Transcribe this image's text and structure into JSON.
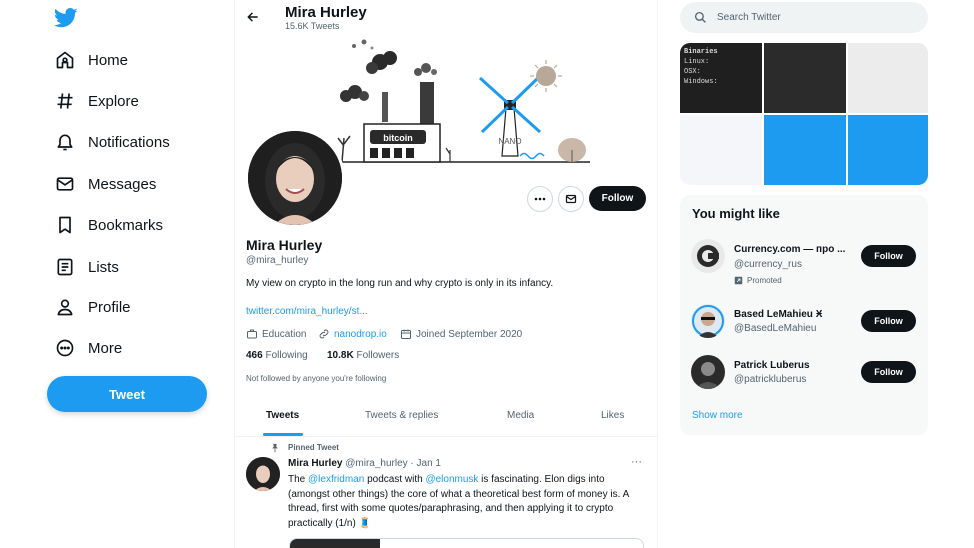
{
  "nav": {
    "items": [
      {
        "label": "Home",
        "icon": "home-icon"
      },
      {
        "label": "Explore",
        "icon": "hashtag-icon"
      },
      {
        "label": "Notifications",
        "icon": "bell-icon"
      },
      {
        "label": "Messages",
        "icon": "envelope-icon"
      },
      {
        "label": "Bookmarks",
        "icon": "bookmark-icon"
      },
      {
        "label": "Lists",
        "icon": "list-icon"
      },
      {
        "label": "Profile",
        "icon": "person-icon"
      },
      {
        "label": "More",
        "icon": "more-circle-icon"
      }
    ],
    "tweet_label": "Tweet"
  },
  "header": {
    "name": "Mira Hurley",
    "tweet_count": "15.6K Tweets"
  },
  "banner": {
    "bitcoin_label": "bitcoin",
    "nano_label": "NANO"
  },
  "profile": {
    "name": "Mira Hurley",
    "handle": "@mira_hurley",
    "bio": "My view on crypto in the long run and why crypto is only in its infancy.",
    "link": "twitter.com/mira_hurley/st...",
    "category": "Education",
    "website": "nanodrop.io",
    "joined": "Joined September 2020",
    "following_count": "466",
    "following_label": "Following",
    "followers_count": "10.8K",
    "followers_label": "Followers",
    "not_followed": "Not followed by anyone you're following",
    "follow_label": "Follow"
  },
  "tabs": [
    "Tweets",
    "Tweets & replies",
    "Media",
    "Likes"
  ],
  "pinned": {
    "label": "Pinned Tweet",
    "name": "Mira Hurley",
    "meta": "@mira_hurley · Jan 1",
    "more": "···",
    "text_1": "The ",
    "mention_1": "@lexfridman",
    "text_2": " podcast with ",
    "mention_2": "@elonmusk",
    "text_3": " is fascinating. Elon digs into (amongst other things) the core of what a theoretical best form of money is. A thread, first with some quotes/paraphrasing, and then applying it to crypto practically (1/n) 🧵"
  },
  "search": {
    "placeholder": "Search Twitter"
  },
  "media_preview": {
    "title": "Binaries",
    "lines": [
      "Linux:",
      "OSX:",
      "Windows:"
    ]
  },
  "wtf": {
    "title": "You might like",
    "suggestions": [
      {
        "name": "Currency.com — про ...",
        "handle": "@currency_rus",
        "follow": "Follow",
        "promoted": "Promoted"
      },
      {
        "name": "Based LeMahieu Ӿ",
        "handle": "@BasedLeMahieu",
        "follow": "Follow"
      },
      {
        "name": "Patrick Luberus",
        "handle": "@patrickluberus",
        "follow": "Follow"
      }
    ],
    "show_more": "Show more"
  },
  "colors": {
    "accent": "#1d9bf0",
    "text": "#0f1419",
    "muted": "#536471",
    "dark_button": "#0f1419"
  }
}
